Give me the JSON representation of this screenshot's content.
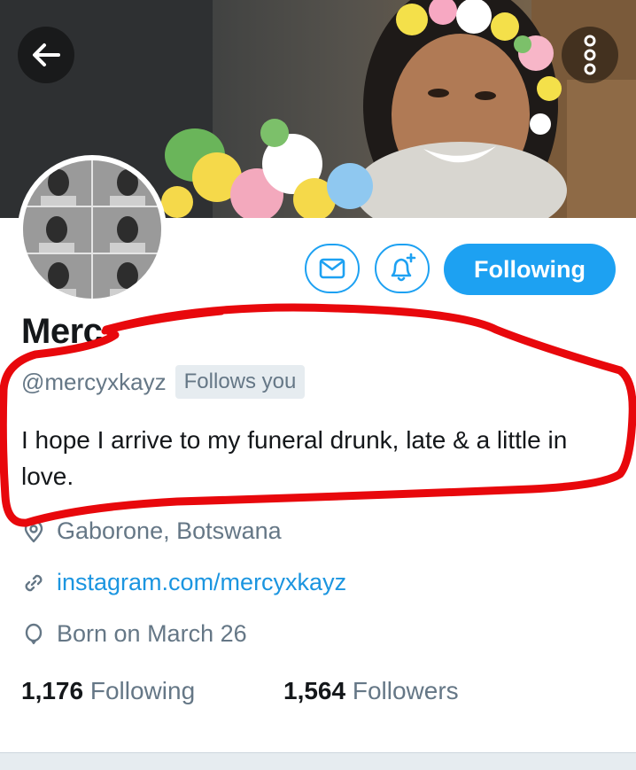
{
  "profile": {
    "display_name": "Merc",
    "handle": "@mercyxkayz",
    "follows_you_badge": "Follows you",
    "bio": "I hope I arrive to my funeral drunk, late & a little in love.",
    "location": "Gaborone, Botswana",
    "website": "instagram.com/mercyxkayz",
    "birthday": "Born on March 26"
  },
  "actions": {
    "following_label": "Following",
    "dm_icon": "envelope-icon",
    "notify_icon": "bell-plus-icon"
  },
  "stats": {
    "following_count": "1,176",
    "following_label": "Following",
    "followers_count": "1,564",
    "followers_label": "Followers"
  },
  "colors": {
    "accent": "#1da1f2",
    "link": "#1b95e0",
    "secondary_text": "#657786",
    "annotation_red": "#e8080c"
  }
}
